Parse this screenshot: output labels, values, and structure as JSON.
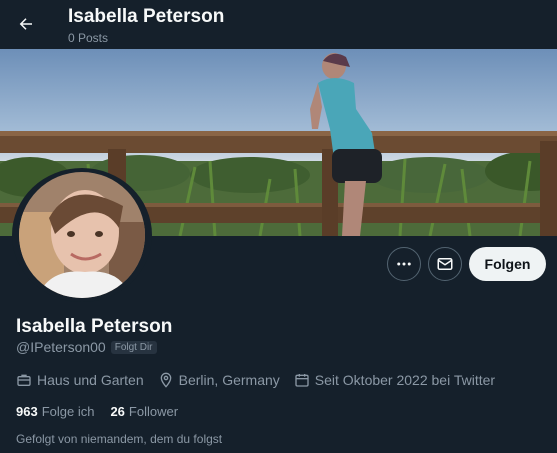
{
  "header": {
    "name": "Isabella Peterson",
    "posts": "0 Posts"
  },
  "profile": {
    "name": "Isabella Peterson",
    "handle": "@IPeterson00",
    "follows_you_badge": "Folgt Dir",
    "follow_label": "Folgen",
    "category": "Haus und Garten",
    "location": "Berlin, Germany",
    "joined": "Seit Oktober 2022 bei Twitter",
    "following_count": "963",
    "following_label": "Folge ich",
    "followers_count": "26",
    "followers_label": "Follower",
    "followed_by": "Gefolgt von niemandem, dem du folgst"
  },
  "icons": {
    "back": "arrow-left-icon",
    "more": "more-icon",
    "message": "envelope-icon",
    "category": "briefcase-icon",
    "location": "location-pin-icon",
    "joined": "calendar-icon"
  },
  "colors": {
    "background": "#15202b",
    "text_primary": "#f7f9f9",
    "text_secondary": "#8b98a5",
    "button_light": "#eff3f4"
  }
}
